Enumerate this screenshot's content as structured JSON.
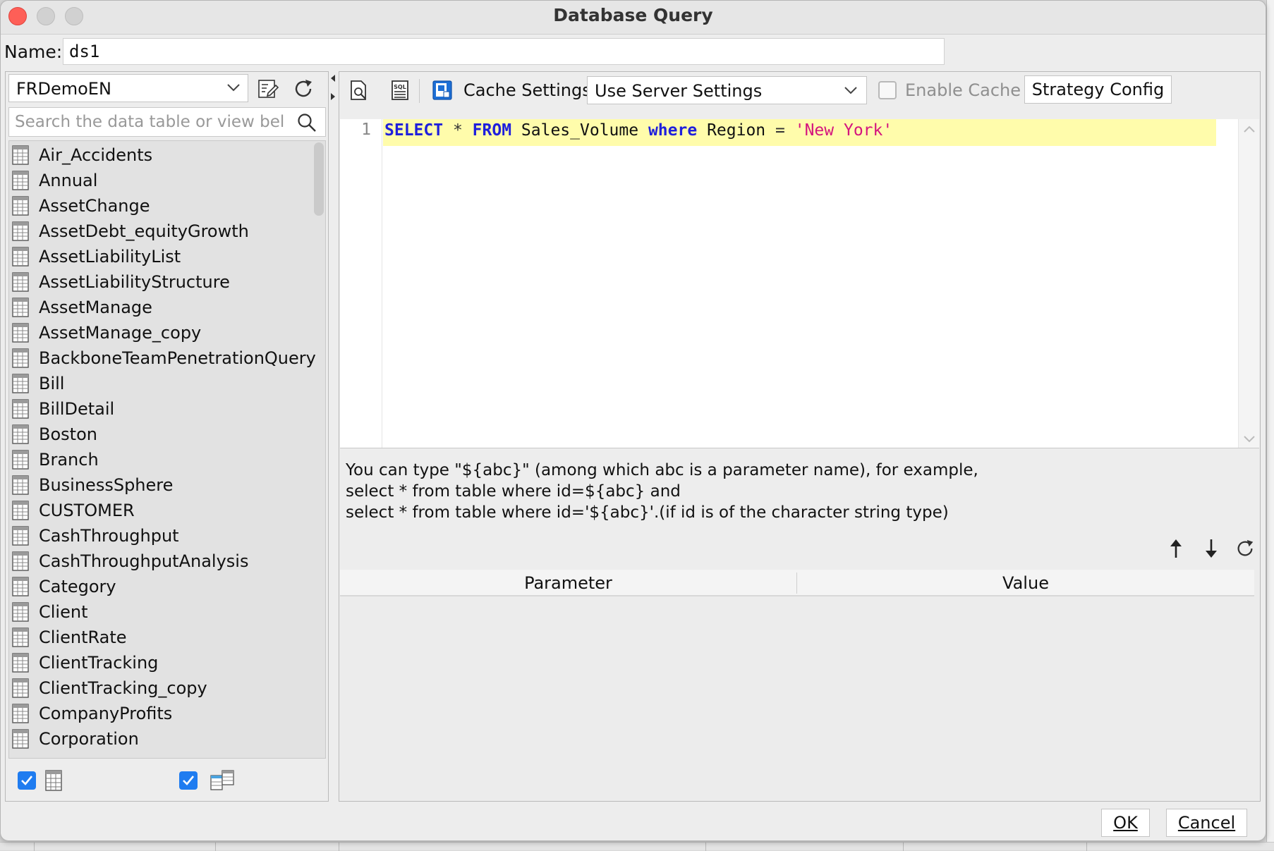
{
  "window": {
    "title": "Database Query"
  },
  "name_field": {
    "label": "Name:",
    "value": "ds1"
  },
  "left_panel": {
    "database": "FRDemoEN",
    "search_placeholder": "Search the data table or view bel",
    "tables": [
      "Air_Accidents",
      "Annual",
      "AssetChange",
      "AssetDebt_equityGrowth",
      "AssetLiabilityList",
      "AssetLiabilityStructure",
      "AssetManage",
      "AssetManage_copy",
      "BackboneTeamPenetrationQuery",
      "Bill",
      "BillDetail",
      "Boston",
      "Branch",
      "BusinessSphere",
      "CUSTOMER",
      "CashThroughput",
      "CashThroughputAnalysis",
      "Category",
      "Client",
      "ClientRate",
      "ClientTracking",
      "ClientTracking_copy",
      "CompanyProfits",
      "Corporation"
    ]
  },
  "toolbar": {
    "cache_settings_label": "Cache Settings",
    "server_settings_value": "Use Server Settings",
    "enable_cache_label": "Enable Cache",
    "strategy_config_label": "Strategy Config"
  },
  "editor": {
    "line_number": "1",
    "sql": {
      "kw1": "SELECT",
      "star": "*",
      "kw2": "FROM",
      "table": "Sales_Volume",
      "kw3": "where",
      "col": "Region",
      "eq": "=",
      "str": "'New York'"
    }
  },
  "hint": {
    "line1": "You can type \"${abc}\" (among which abc is a parameter name), for example,",
    "line2": "select * from table where id=${abc} and",
    "line3": "select * from table where id='${abc}'.(if id is of the character string type)"
  },
  "param_table": {
    "col_parameter": "Parameter",
    "col_value": "Value"
  },
  "buttons": {
    "ok": "OK",
    "cancel": "Cancel"
  },
  "colors": {
    "accent_checkbox": "#1f7cf0",
    "keyword": "#1f1fdc",
    "string": "#d4147e",
    "highlight_line": "#fffcab",
    "close_button": "#fe5f57"
  }
}
